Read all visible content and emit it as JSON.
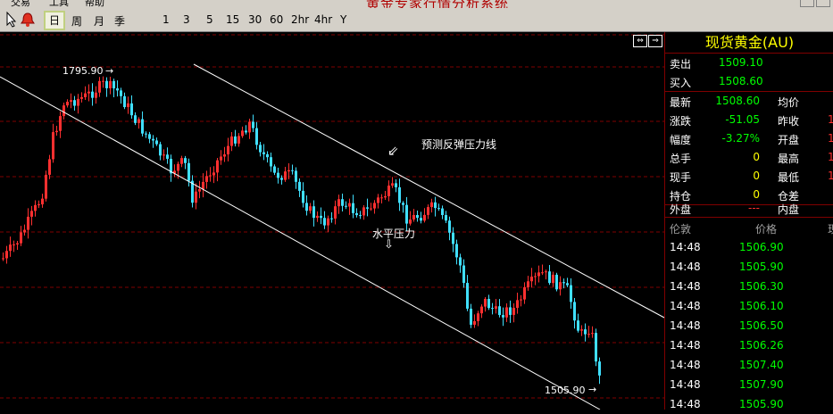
{
  "app_title": "黄金专家行情分析系统",
  "menu": [
    "交易",
    "工具",
    "帮助"
  ],
  "periods": [
    "日",
    "周",
    "月",
    "季",
    "1",
    "3",
    "5",
    "15",
    "30",
    "60",
    "2hr",
    "4hr",
    "Y"
  ],
  "chart": {
    "high_label": "1795.90",
    "low_label": "1505.90",
    "annotation_rebound": "预测反弹压力线",
    "annotation_horizontal": "水平压力",
    "arrow_rebound": "⇙",
    "arrow_horizontal": "⇩"
  },
  "quote": {
    "title": "现货黄金(AU)",
    "sell_label": "卖出",
    "sell_value": "1509.10",
    "buy_label": "买入",
    "buy_value": "1508.60",
    "rows": [
      {
        "l1": "最新",
        "v1": "1508.60",
        "l2": "均价",
        "v2": ""
      },
      {
        "l1": "涨跌",
        "v1": "-51.05",
        "l2": "昨收",
        "v2": "1"
      },
      {
        "l1": "幅度",
        "v1": "-3.27%",
        "l2": "开盘",
        "v2": "1"
      },
      {
        "l1": "总手",
        "v1": "0",
        "l2": "最高",
        "v2": "1"
      },
      {
        "l1": "现手",
        "v1": "0",
        "l2": "最低",
        "v2": "1"
      },
      {
        "l1": "持仓",
        "v1": "0",
        "l2": "仓差",
        "v2": ""
      }
    ],
    "outer_label": "外盘",
    "outer_value": "---",
    "inner_label": "内盘",
    "ticks_header": {
      "time": "伦敦",
      "price": "价格",
      "vol": "现"
    },
    "ticks": [
      {
        "time": "14:48",
        "price": "1506.90"
      },
      {
        "time": "14:48",
        "price": "1505.90"
      },
      {
        "time": "14:48",
        "price": "1506.30"
      },
      {
        "time": "14:48",
        "price": "1506.10"
      },
      {
        "time": "14:48",
        "price": "1506.50"
      },
      {
        "time": "14:48",
        "price": "1506.26"
      },
      {
        "time": "14:48",
        "price": "1507.40"
      },
      {
        "time": "14:48",
        "price": "1507.90"
      },
      {
        "time": "14:48",
        "price": "1505.90"
      }
    ]
  }
}
